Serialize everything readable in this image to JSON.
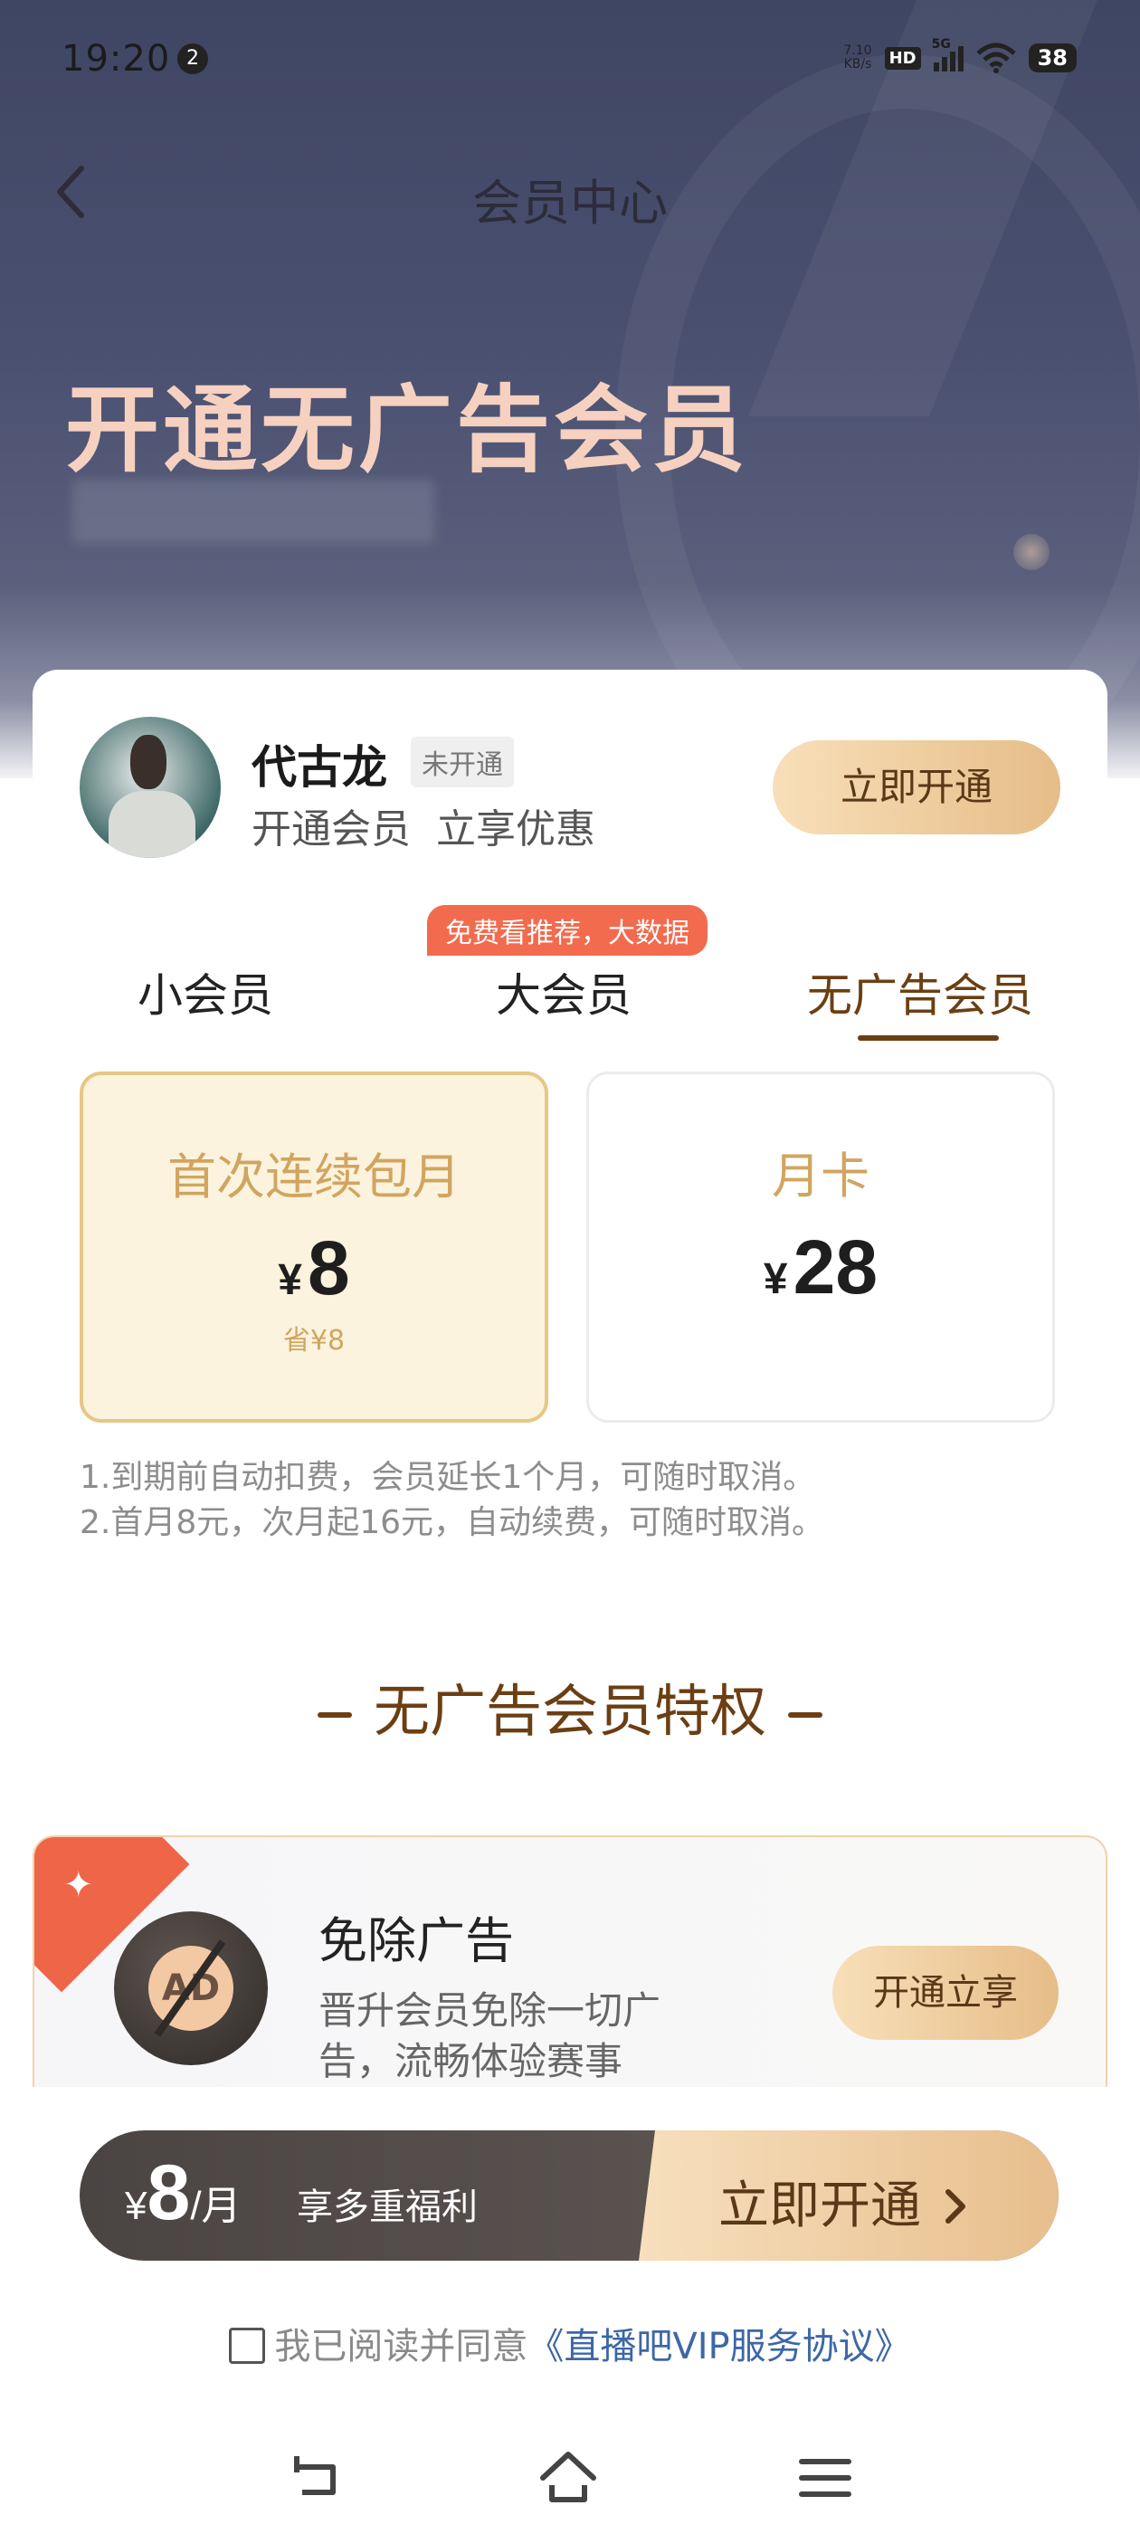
{
  "status_bar": {
    "time": "19:20",
    "notification_count": "2",
    "net_speed_value": "7.10",
    "net_speed_unit": "KB/s",
    "hd_label": "HD",
    "network_label": "5G",
    "battery": "38"
  },
  "nav": {
    "title": "会员中心"
  },
  "hero": {
    "title": "开通无广告会员"
  },
  "user": {
    "name": "代古龙",
    "status_badge": "未开通",
    "subtitle": "开通会员  立享优惠",
    "open_button": "立即开通"
  },
  "tabs": {
    "promo_tag": "免费看推荐，大数据",
    "items": [
      {
        "label": "小会员"
      },
      {
        "label": "大会员"
      },
      {
        "label": "无广告会员"
      }
    ],
    "selected": "无广告会员"
  },
  "plans": [
    {
      "name": "首次连续包月",
      "currency": "¥",
      "price": "8",
      "save": "省¥8",
      "selected": true
    },
    {
      "name": "月卡",
      "currency": "¥",
      "price": "28",
      "selected": false
    }
  ],
  "notes": [
    "1.到期前自动扣费，会员延长1个月，可随时取消。",
    "2.首月8元，次月起16元，自动续费，可随时取消。"
  ],
  "privileges": {
    "title": "无广告会员特权",
    "items": [
      {
        "icon_text": "AD",
        "name": "免除广告",
        "desc": "晋升会员免除一切广告，流畅体验赛事",
        "button": "开通立享"
      }
    ]
  },
  "purchase_bar": {
    "currency": "¥",
    "price": "8",
    "unit": "/月",
    "benefit": "享多重福利",
    "cta": "立即开通"
  },
  "agreement": {
    "text": "我已阅读并同意",
    "link": "《直播吧VIP服务协议》",
    "checked": false
  },
  "colors": {
    "accent_gold": "#e6bd88",
    "accent_brown": "#6b3f13",
    "promo_red": "#f26b4e"
  }
}
